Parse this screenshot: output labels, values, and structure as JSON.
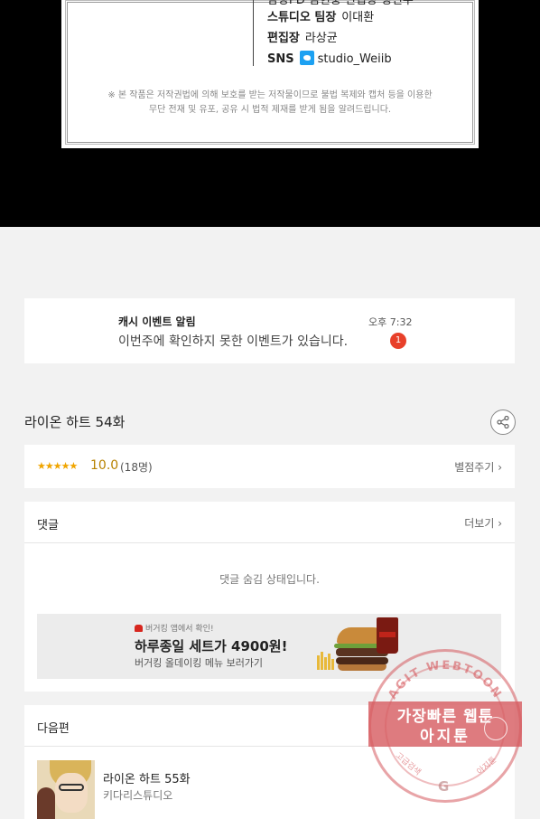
{
  "credits": {
    "cut_line": "담당PD 김현중   편집장 정연우",
    "rows": [
      {
        "role": "스튜디오 팀장",
        "name": "이대환"
      },
      {
        "role": "편집장",
        "name": "라상균"
      },
      {
        "role": "SNS",
        "name": "studio_Weiib"
      }
    ],
    "notice_line1": "※ 본 작품은 저작권법에 의해 보호를 받는 저작물이므로 불법 복제와 캡처 등을 이용한",
    "notice_line2": "무단 전재 및 유포, 공유 시 법적 제재를 받게 됨을 알려드립니다."
  },
  "notification": {
    "title": "캐시 이벤트 알림",
    "time": "오후 7:32",
    "body": "이번주에 확인하지 못한 이벤트가 있습니다.",
    "badge": "1"
  },
  "episode": {
    "title": "라이온 하트 54화"
  },
  "rating": {
    "stars": "★★★★★",
    "score": "10.0",
    "count": "(18명)",
    "rate_label": "별점주기 ›"
  },
  "comments": {
    "title": "댓글",
    "more_label": "더보기 ›",
    "hidden_message": "댓글 숨김 상태입니다."
  },
  "ad": {
    "small": "버거킹 앱에서 확인!",
    "headline": "하루종일 세트가 4900원!",
    "sub": "버거킹 올데이킹 메뉴 보러가기"
  },
  "next": {
    "title": "다음편",
    "episode_title": "라이온 하트 55화",
    "studio": "키다리스튜디오"
  },
  "watermark": {
    "arc_text": "AGIT WEBTOON",
    "line1": "가장빠른 웹툰",
    "line2": "아지툰",
    "left_small": "고급검색",
    "right_small": "아지툰",
    "google": "G"
  },
  "colors": {
    "badge": "#e8402a",
    "star": "#f0a500",
    "watermark": "#d65a5f"
  }
}
